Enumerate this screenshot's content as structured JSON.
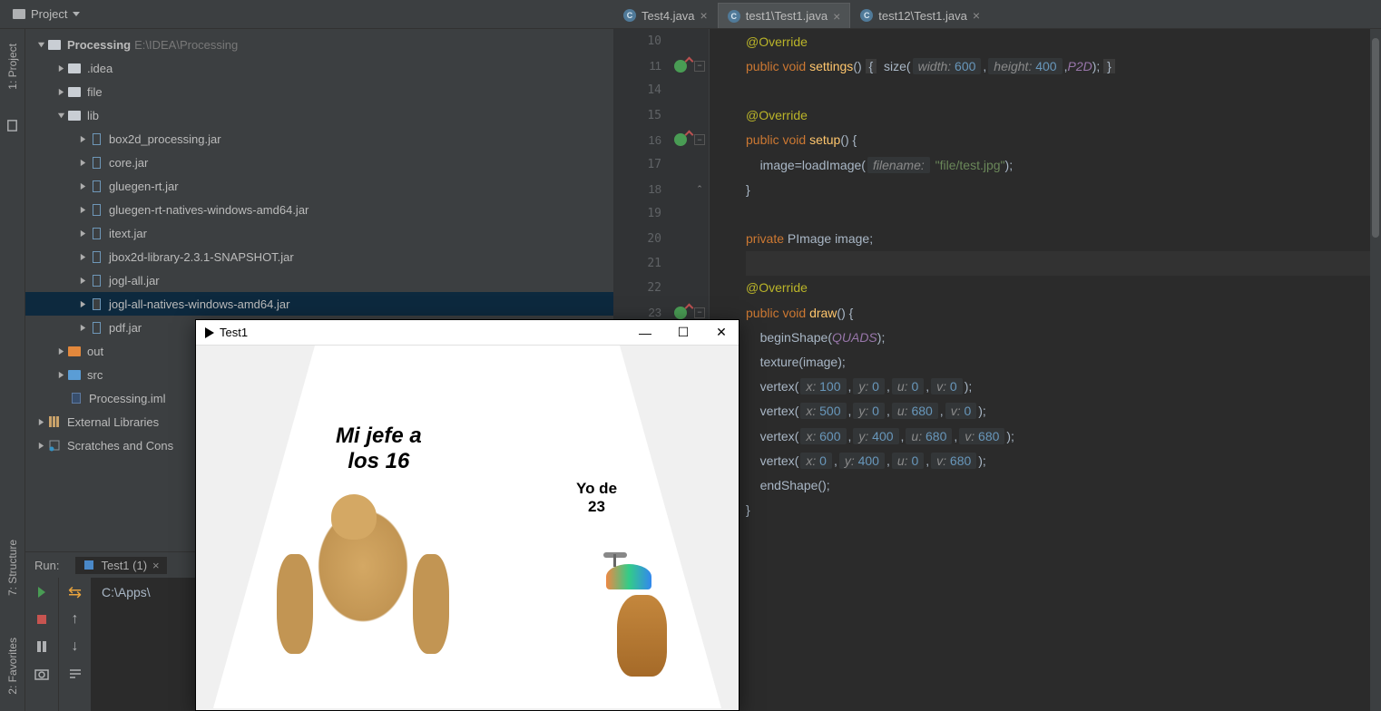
{
  "toolbar": {
    "project_label": "Project"
  },
  "sidebar": {
    "tabs": [
      "1: Project",
      "7: Structure",
      "2: Favorites"
    ]
  },
  "project_tree": {
    "root": {
      "name": "Processing",
      "path": "E:\\IDEA\\Processing"
    },
    "idea": ".idea",
    "file": "file",
    "lib": "lib",
    "jars": [
      "box2d_processing.jar",
      "core.jar",
      "gluegen-rt.jar",
      "gluegen-rt-natives-windows-amd64.jar",
      "itext.jar",
      "jbox2d-library-2.3.1-SNAPSHOT.jar",
      "jogl-all.jar",
      "jogl-all-natives-windows-amd64.jar",
      "pdf.jar"
    ],
    "out": "out",
    "src": "src",
    "iml": "Processing.iml",
    "ext_lib": "External Libraries",
    "scratches": "Scratches and Cons"
  },
  "editor_tabs": [
    {
      "label": "Test4.java"
    },
    {
      "label": "test1\\Test1.java"
    },
    {
      "label": "test12\\Test1.java"
    }
  ],
  "gutter": {
    "lines": [
      "10",
      "11",
      "14",
      "15",
      "16",
      "17",
      "18",
      "19",
      "20",
      "21",
      "22",
      "23"
    ],
    "icons": {
      "11": true,
      "16": true,
      "23": true
    }
  },
  "code": {
    "l10": "@Override",
    "l11a": "public",
    "l11b": "void",
    "l11c": "settings",
    "l11d": "size",
    "l11w": "width:",
    "l11wv": "600",
    "l11h": "height:",
    "l11hv": "400",
    "l11p": "P2D",
    "l15": "@Override",
    "l16a": "public",
    "l16b": "void",
    "l16c": "setup",
    "l17a": "image",
    "l17b": "loadImage",
    "l17f": "filename:",
    "l17s": "\"file/test.jpg\"",
    "l20a": "private",
    "l20b": "PImage",
    "l20c": "image",
    "l22": "@Override",
    "l23a": "public",
    "l23b": "void",
    "l23c": "draw",
    "l24a": "beginShape",
    "l24b": "QUADS",
    "l25a": "texture",
    "l25b": "image",
    "l26": "vertex",
    "l26x": "x:",
    "l26xv": "100",
    "l26y": "y:",
    "l26yv": "0",
    "l26u": "u:",
    "l26uv": "0",
    "l26v": "v:",
    "l26vv": "0",
    "l27x": "500",
    "l27y": "0",
    "l27u": "680",
    "l27v": "0",
    "l28x": "600",
    "l28y": "400",
    "l28u": "680",
    "l28v": "680",
    "l29x": "0",
    "l29y": "400",
    "l29u": "0",
    "l29v": "680",
    "l30": "endShape"
  },
  "run": {
    "label": "Run:",
    "tab": "Test1 (1)",
    "output": "C:\\Apps\\"
  },
  "window": {
    "title": "Test1",
    "meme1a": "Mi jefe a",
    "meme1b": "los 16",
    "meme2a": "Yo de",
    "meme2b": "23"
  }
}
